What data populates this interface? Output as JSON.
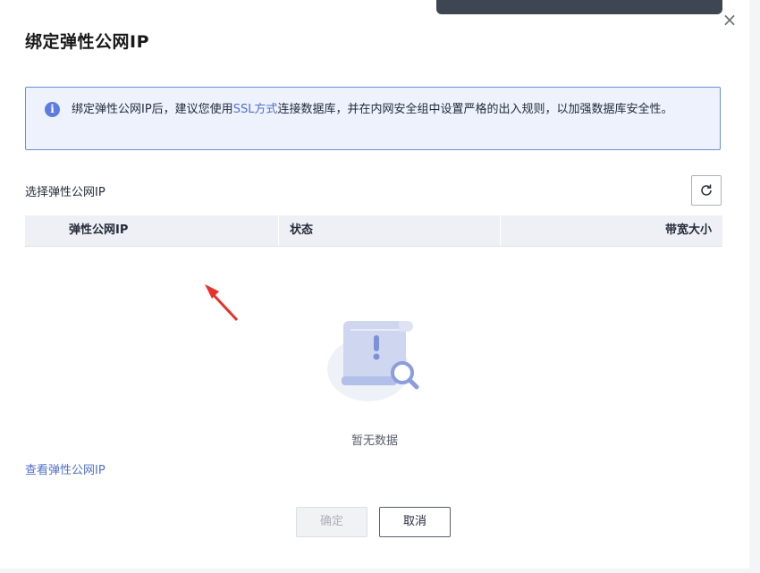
{
  "dialog": {
    "title": "绑定弹性公网IP",
    "close_label": "×"
  },
  "info": {
    "icon": "info-icon",
    "text_before": "绑定弹性公网IP后，建议您使用",
    "link": "SSL方式",
    "text_after": "连接数据库，并在内网安全组中设置严格的出入规则，以加强数据库安全性。"
  },
  "select": {
    "label": "选择弹性公网IP",
    "refresh_icon": "refresh-icon"
  },
  "table": {
    "columns": [
      "弹性公网IP",
      "状态",
      "带宽大小"
    ],
    "rows": []
  },
  "empty": {
    "text": "暂无数据"
  },
  "links": {
    "view_eip": "查看弹性公网IP"
  },
  "buttons": {
    "ok": "确定",
    "cancel": "取消"
  },
  "colors": {
    "accent": "#526ecc",
    "info_border": "#6a8fd6",
    "info_bg": "#edf2fd",
    "pointer_arrow": "#e8312a"
  }
}
